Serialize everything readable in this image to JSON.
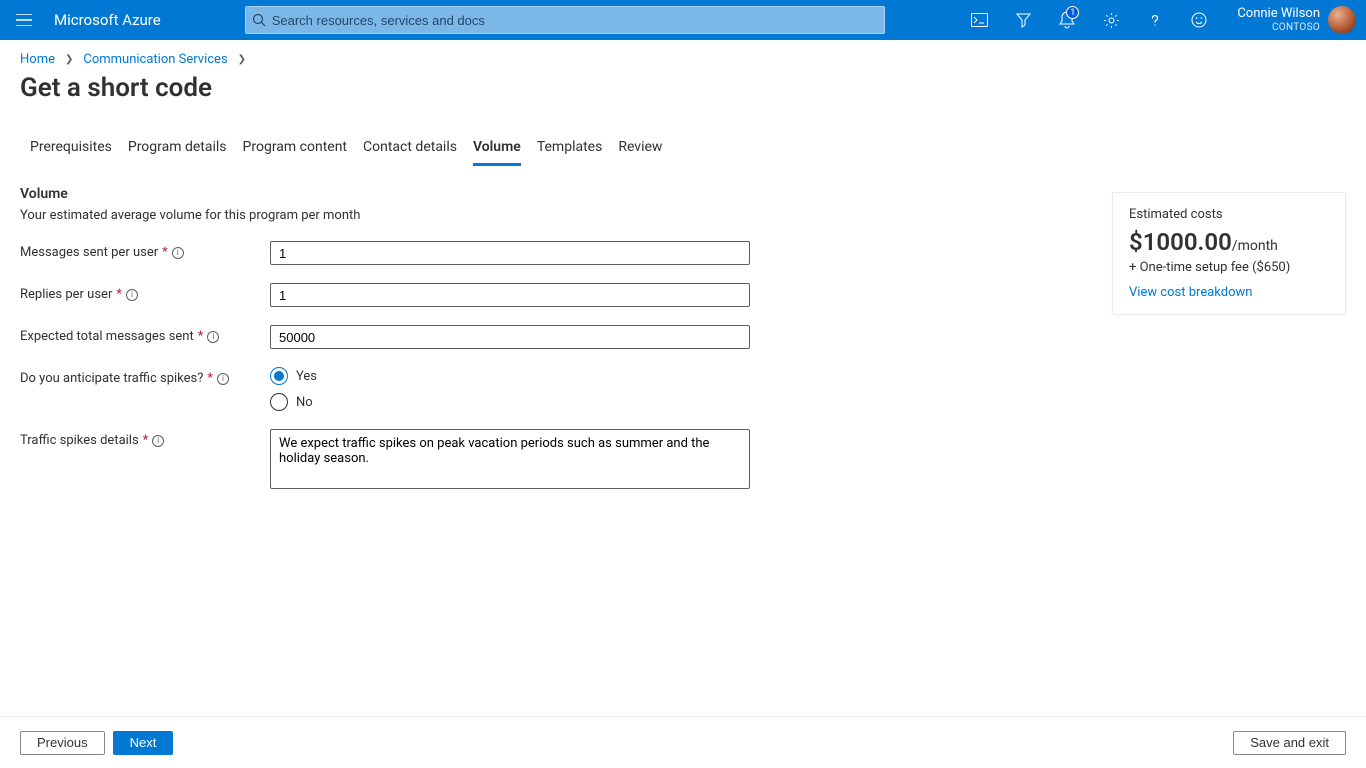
{
  "header": {
    "brand": "Microsoft Azure",
    "search_placeholder": "Search resources, services and docs",
    "notification_count": "1",
    "user_name": "Connie Wilson",
    "tenant": "CONTOSO"
  },
  "breadcrumb": {
    "items": [
      "Home",
      "Communication Services"
    ]
  },
  "page_title": "Get a short code",
  "tabs": [
    {
      "label": "Prerequisites"
    },
    {
      "label": "Program details"
    },
    {
      "label": "Program content"
    },
    {
      "label": "Contact details"
    },
    {
      "label": "Volume",
      "active": true
    },
    {
      "label": "Templates"
    },
    {
      "label": "Review"
    }
  ],
  "volume": {
    "heading": "Volume",
    "subheading": "Your estimated average volume for this program per month",
    "messages_sent_label": "Messages sent per user",
    "messages_sent_value": "1",
    "replies_label": "Replies per user",
    "replies_value": "1",
    "expected_total_label": "Expected total messages sent",
    "expected_total_value": "50000",
    "traffic_spikes_label": "Do you anticipate traffic spikes?",
    "traffic_yes": "Yes",
    "traffic_no": "No",
    "traffic_details_label": "Traffic spikes details",
    "traffic_details_value": "We expect traffic spikes on peak vacation periods such as summer and the holiday season."
  },
  "cost": {
    "label": "Estimated costs",
    "amount": "$1000.00",
    "suffix": "/month",
    "fee": "+ One-time setup fee ($650)",
    "link": "View cost breakdown"
  },
  "footer": {
    "previous": "Previous",
    "next": "Next",
    "save_exit": "Save and exit"
  }
}
